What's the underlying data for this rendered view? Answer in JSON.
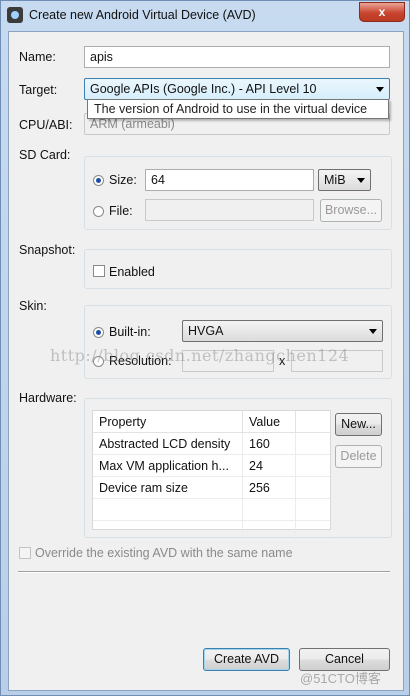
{
  "window": {
    "title": "Create new Android Virtual Device (AVD)",
    "close_glyph": "x"
  },
  "form": {
    "name_label": "Name:",
    "name_value": "apis",
    "target_label": "Target:",
    "target_value": "Google APIs (Google Inc.) - API Level 10",
    "target_tooltip": "The version of Android to use in the virtual device",
    "cpu_label": "CPU/ABI:",
    "cpu_value": "ARM (armeabi)",
    "sdcard_label": "SD Card:",
    "size_label": "Size:",
    "size_value": "64",
    "size_unit": "MiB",
    "file_label": "File:",
    "file_value": "",
    "browse_label": "Browse...",
    "snapshot_label": "Snapshot:",
    "enabled_label": "Enabled",
    "skin_label": "Skin:",
    "builtin_label": "Built-in:",
    "builtin_value": "HVGA",
    "resolution_label": "Resolution:",
    "resolution_x": "x",
    "hardware_label": "Hardware:",
    "new_label": "New...",
    "delete_label": "Delete",
    "override_label": "Override the existing AVD with the same name"
  },
  "hardware_table": {
    "columns": [
      "Property",
      "Value"
    ],
    "rows": [
      {
        "property": "Abstracted LCD density",
        "value": "160"
      },
      {
        "property": "Max VM application h...",
        "value": "24"
      },
      {
        "property": "Device ram size",
        "value": "256"
      }
    ]
  },
  "footer": {
    "create_label": "Create AVD",
    "cancel_label": "Cancel"
  },
  "watermarks": {
    "url": "http://blog.csdn.net/zhangchen124",
    "site": "@51CTO博客"
  }
}
